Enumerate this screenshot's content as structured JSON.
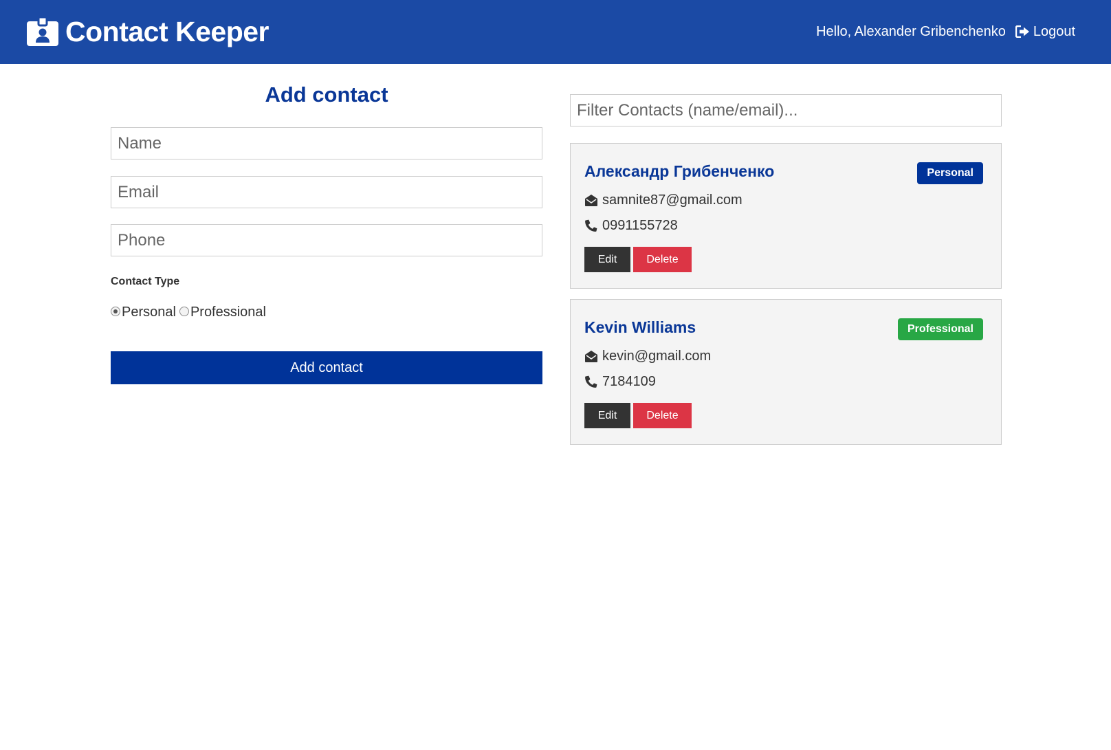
{
  "navbar": {
    "brand_icon": "id-badge-icon",
    "title": "Contact Keeper",
    "greeting": "Hello, Alexander Gribenchenko",
    "logout_icon": "sign-out-icon",
    "logout_label": "Logout",
    "background": "#1b4aa5"
  },
  "form": {
    "title": "Add contact",
    "name_placeholder": "Name",
    "email_placeholder": "Email",
    "phone_placeholder": "Phone",
    "type_label": "Contact Type",
    "types": [
      {
        "label": "Personal",
        "selected": true
      },
      {
        "label": "Professional",
        "selected": false
      }
    ],
    "submit_label": "Add contact"
  },
  "filter": {
    "placeholder": "Filter Contacts (name/email)..."
  },
  "contacts": [
    {
      "name": "Александр Грибенченко",
      "type": "Personal",
      "type_color": "#003399",
      "email_icon": "envelope-open-icon",
      "email": "samnite87@gmail.com",
      "phone_icon": "phone-icon",
      "phone": "0991155728",
      "edit_label": "Edit",
      "delete_label": "Delete"
    },
    {
      "name": "Kevin Williams",
      "type": "Professional",
      "type_color": "#28a745",
      "email_icon": "envelope-open-icon",
      "email": "kevin@gmail.com",
      "phone_icon": "phone-icon",
      "phone": "7184109",
      "edit_label": "Edit",
      "delete_label": "Delete"
    }
  ],
  "colors": {
    "primary": "#003399",
    "title_blue": "#0a3797",
    "danger": "#dc3545",
    "success": "#28a745",
    "dark": "#333333",
    "card_bg": "#f4f4f4"
  }
}
